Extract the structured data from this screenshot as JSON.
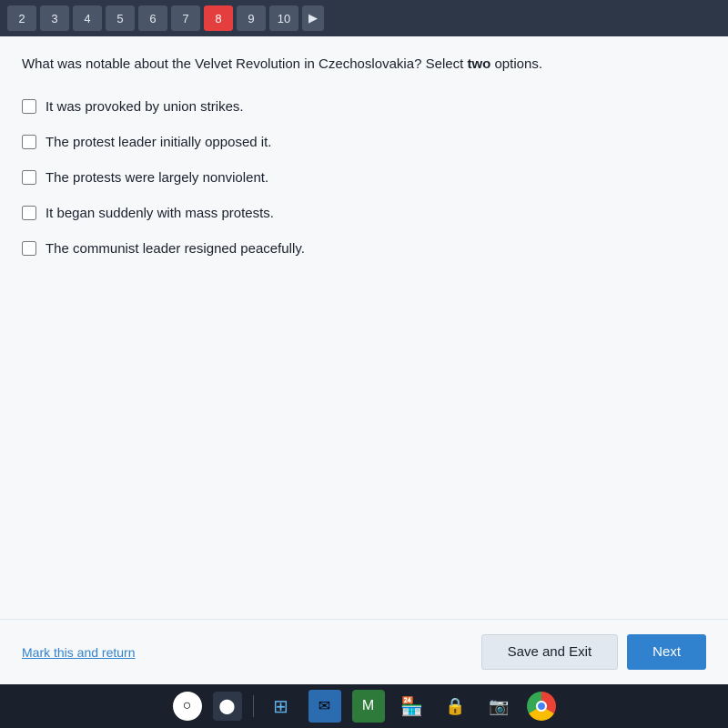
{
  "nav": {
    "items": [
      {
        "label": "2",
        "active": false
      },
      {
        "label": "3",
        "active": false
      },
      {
        "label": "4",
        "active": false
      },
      {
        "label": "5",
        "active": false
      },
      {
        "label": "6",
        "active": false
      },
      {
        "label": "7",
        "active": false
      },
      {
        "label": "8",
        "active": true
      },
      {
        "label": "9",
        "active": false
      },
      {
        "label": "10",
        "active": false
      }
    ],
    "arrow_label": "▶"
  },
  "question": {
    "text_before_bold": "What was notable about the Velvet Revolution in Czechoslovakia? Select ",
    "bold_word": "two",
    "text_after_bold": " options."
  },
  "options": [
    {
      "label": "It was provoked by union strikes.",
      "checked": false
    },
    {
      "label": "The protest leader initially opposed it.",
      "checked": false
    },
    {
      "label": "The protests were largely nonviolent.",
      "checked": false
    },
    {
      "label": "It began suddenly with mass protests.",
      "checked": false
    },
    {
      "label": "The communist leader resigned peacefully.",
      "checked": false
    }
  ],
  "footer": {
    "mark_return_label": "Mark this and return",
    "save_exit_label": "Save and Exit",
    "next_label": "Next"
  },
  "taskbar": {
    "icons": [
      "⊞",
      "✉",
      "🎮",
      "🏪",
      "🔒",
      "📷",
      "⬤"
    ]
  }
}
